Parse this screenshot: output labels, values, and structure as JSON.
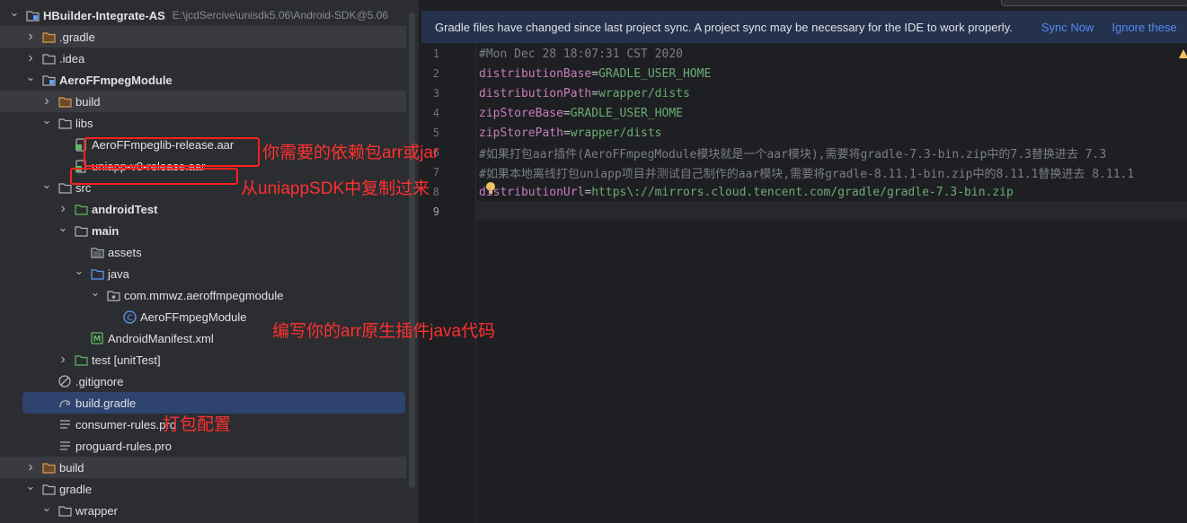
{
  "tree": {
    "items": [
      {
        "label": "HBuilder-Integrate-AS",
        "path": "E:\\jcdSercive\\unisdk5.06\\Android-SDK@5.06",
        "type": "module",
        "indent": 0,
        "expanded": true,
        "bold": true
      },
      {
        "label": ".gradle",
        "type": "folder-orange",
        "indent": 1,
        "expanded": false
      },
      {
        "label": ".idea",
        "type": "folder",
        "indent": 1,
        "expanded": false
      },
      {
        "label": "AeroFFmpegModule",
        "type": "module",
        "indent": 1,
        "expanded": true,
        "bold": true
      },
      {
        "label": "build",
        "type": "folder-orange",
        "indent": 2,
        "expanded": false
      },
      {
        "label": "libs",
        "type": "folder",
        "indent": 2,
        "expanded": true
      },
      {
        "label": "AeroFFmpeglib-release.aar",
        "type": "archive",
        "indent": 3
      },
      {
        "label": "uniapp-v8-release.aar",
        "type": "archive",
        "indent": 3
      },
      {
        "label": "src",
        "type": "folder",
        "indent": 2,
        "expanded": true
      },
      {
        "label": "androidTest",
        "type": "folder-test",
        "indent": 3,
        "expanded": false,
        "bold": true
      },
      {
        "label": "main",
        "type": "folder-main",
        "indent": 3,
        "expanded": true,
        "bold": true
      },
      {
        "label": "assets",
        "type": "folder-assets",
        "indent": 4
      },
      {
        "label": "java",
        "type": "folder-blue",
        "indent": 4,
        "expanded": true
      },
      {
        "label": "com.mmwz.aeroffmpegmodule",
        "type": "package",
        "indent": 5,
        "expanded": true
      },
      {
        "label": "AeroFFmpegModule",
        "type": "class",
        "indent": 6
      },
      {
        "label": "AndroidManifest.xml",
        "type": "manifest",
        "indent": 4
      },
      {
        "label": "test [unitTest]",
        "type": "folder-test",
        "indent": 3,
        "expanded": false
      },
      {
        "label": ".gitignore",
        "type": "ignore",
        "indent": 2
      },
      {
        "label": "build.gradle",
        "type": "gradle",
        "indent": 2,
        "selected": true
      },
      {
        "label": "consumer-rules.pro",
        "type": "text",
        "indent": 2
      },
      {
        "label": "proguard-rules.pro",
        "type": "text",
        "indent": 2
      },
      {
        "label": "build",
        "type": "folder-orange",
        "indent": 1,
        "expanded": false
      },
      {
        "label": "gradle",
        "type": "folder",
        "indent": 1,
        "expanded": true
      },
      {
        "label": "wrapper",
        "type": "folder",
        "indent": 2,
        "expanded": true
      }
    ]
  },
  "banner": {
    "message": "Gradle files have changed since last project sync. A project sync may be necessary for the IDE to work properly.",
    "sync_now": "Sync Now",
    "ignore": "Ignore these"
  },
  "editor": {
    "lines": [
      {
        "n": "1",
        "parts": [
          {
            "t": "#Mon Dec 28 18:07:31 CST 2020",
            "c": "cmt"
          }
        ]
      },
      {
        "n": "2",
        "parts": [
          {
            "t": "distributionBase",
            "c": "key"
          },
          {
            "t": "=",
            "c": "eq"
          },
          {
            "t": "GRADLE_USER_HOME",
            "c": "val"
          }
        ]
      },
      {
        "n": "3",
        "parts": [
          {
            "t": "distributionPath",
            "c": "key"
          },
          {
            "t": "=",
            "c": "eq"
          },
          {
            "t": "wrapper/dists",
            "c": "val"
          }
        ]
      },
      {
        "n": "4",
        "parts": [
          {
            "t": "zipStoreBase",
            "c": "key"
          },
          {
            "t": "=",
            "c": "eq"
          },
          {
            "t": "GRADLE_USER_HOME",
            "c": "val"
          }
        ]
      },
      {
        "n": "5",
        "parts": [
          {
            "t": "zipStorePath",
            "c": "key"
          },
          {
            "t": "=",
            "c": "eq"
          },
          {
            "t": "wrapper/dists",
            "c": "val"
          }
        ]
      },
      {
        "n": "6",
        "parts": [
          {
            "t": "#如果打包aar插件(AeroFFmpegModule模块就是一个aar模块),需要将gradle-7.3-bin.zip中的7.3替换进去 7.3",
            "c": "cmt"
          }
        ]
      },
      {
        "n": "7",
        "parts": [
          {
            "t": "#如果本地离线打包uniapp项目并测试自己制作的aar模块,需要将gradle-8.11.1-bin.zip中的8.11.1替换进去 8.11.1",
            "c": "cmt"
          }
        ]
      },
      {
        "n": "8",
        "parts": [
          {
            "t": "distributionUrl",
            "c": "key"
          },
          {
            "t": "=",
            "c": "eq"
          },
          {
            "t": "https\\://mirrors.cloud.tencent.com/gradle/gradle-7.3-bin.zip",
            "c": "val"
          }
        ]
      },
      {
        "n": "9",
        "parts": []
      }
    ]
  },
  "annotations": {
    "a1": "你需要的依赖包arr或jar",
    "a2": "从uniappSDK中复制过来",
    "a3": "编写你的arr原生插件java代码",
    "a4": "打包配置"
  },
  "colors": {
    "accent": "#548af7",
    "annotation": "#ff2020",
    "banner_bg": "#25324d",
    "selection": "#2e436e"
  }
}
